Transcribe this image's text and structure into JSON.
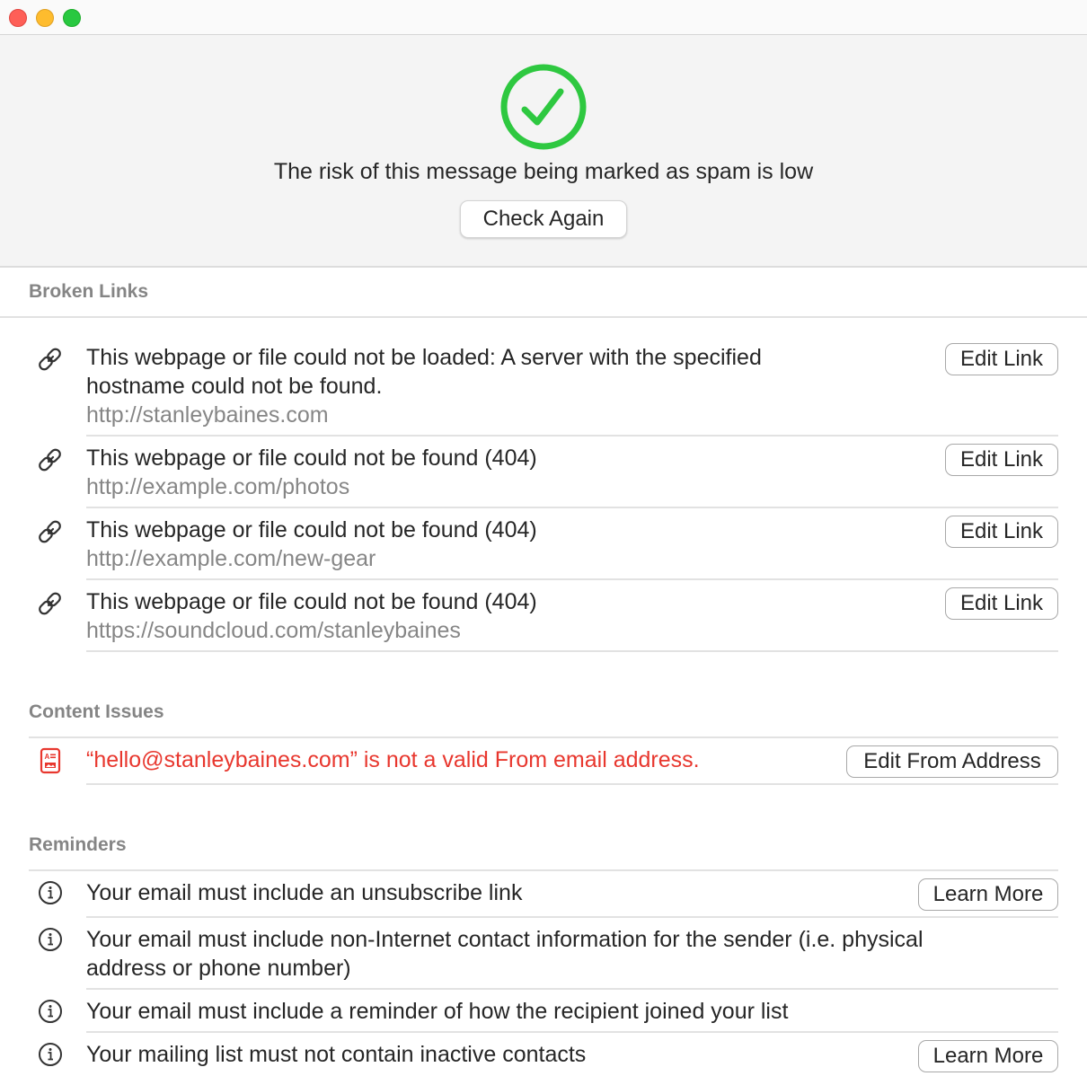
{
  "window": {
    "controls": [
      "close",
      "minimize",
      "maximize"
    ]
  },
  "header": {
    "status_icon": "checkmark-circle-icon",
    "status_color": "#2ec840",
    "message": "The risk of this message being marked as spam is low",
    "check_again_label": "Check Again"
  },
  "broken_links": {
    "title": "Broken Links",
    "items": [
      {
        "icon": "link-icon",
        "message_line1": "This webpage or file could not be loaded: A server with the specified",
        "message_line2": "hostname could not be found.",
        "url": "http://stanleybaines.com",
        "button_label": "Edit Link"
      },
      {
        "icon": "link-icon",
        "message_line1": "This webpage or file could not be found (404)",
        "url": "http://example.com/photos",
        "button_label": "Edit Link"
      },
      {
        "icon": "link-icon",
        "message_line1": "This webpage or file could not be found (404)",
        "url": "http://example.com/new-gear",
        "button_label": "Edit Link"
      },
      {
        "icon": "link-icon",
        "message_line1": "This webpage or file could not be found (404)",
        "url": "https://soundcloud.com/stanleybaines",
        "button_label": "Edit Link"
      }
    ]
  },
  "content_issues": {
    "title": "Content Issues",
    "error_color": "#e8372e",
    "items": [
      {
        "icon": "contact-card-icon",
        "message": "“hello@stanleybaines.com” is not a valid From email address.",
        "button_label": "Edit From Address"
      }
    ]
  },
  "reminders": {
    "title": "Reminders",
    "items": [
      {
        "icon": "info-icon",
        "message_line1": "Your email must include an unsubscribe link",
        "button_label": "Learn More"
      },
      {
        "icon": "info-icon",
        "message_line1": "Your email must include non-Internet contact information for the sender (i.e. physical",
        "message_line2": "address or phone number)"
      },
      {
        "icon": "info-icon",
        "message_line1": "Your email must include a reminder of how the recipient joined your list"
      },
      {
        "icon": "info-icon",
        "message_line1": "Your mailing list must not contain inactive contacts",
        "button_label": "Learn More"
      }
    ]
  }
}
